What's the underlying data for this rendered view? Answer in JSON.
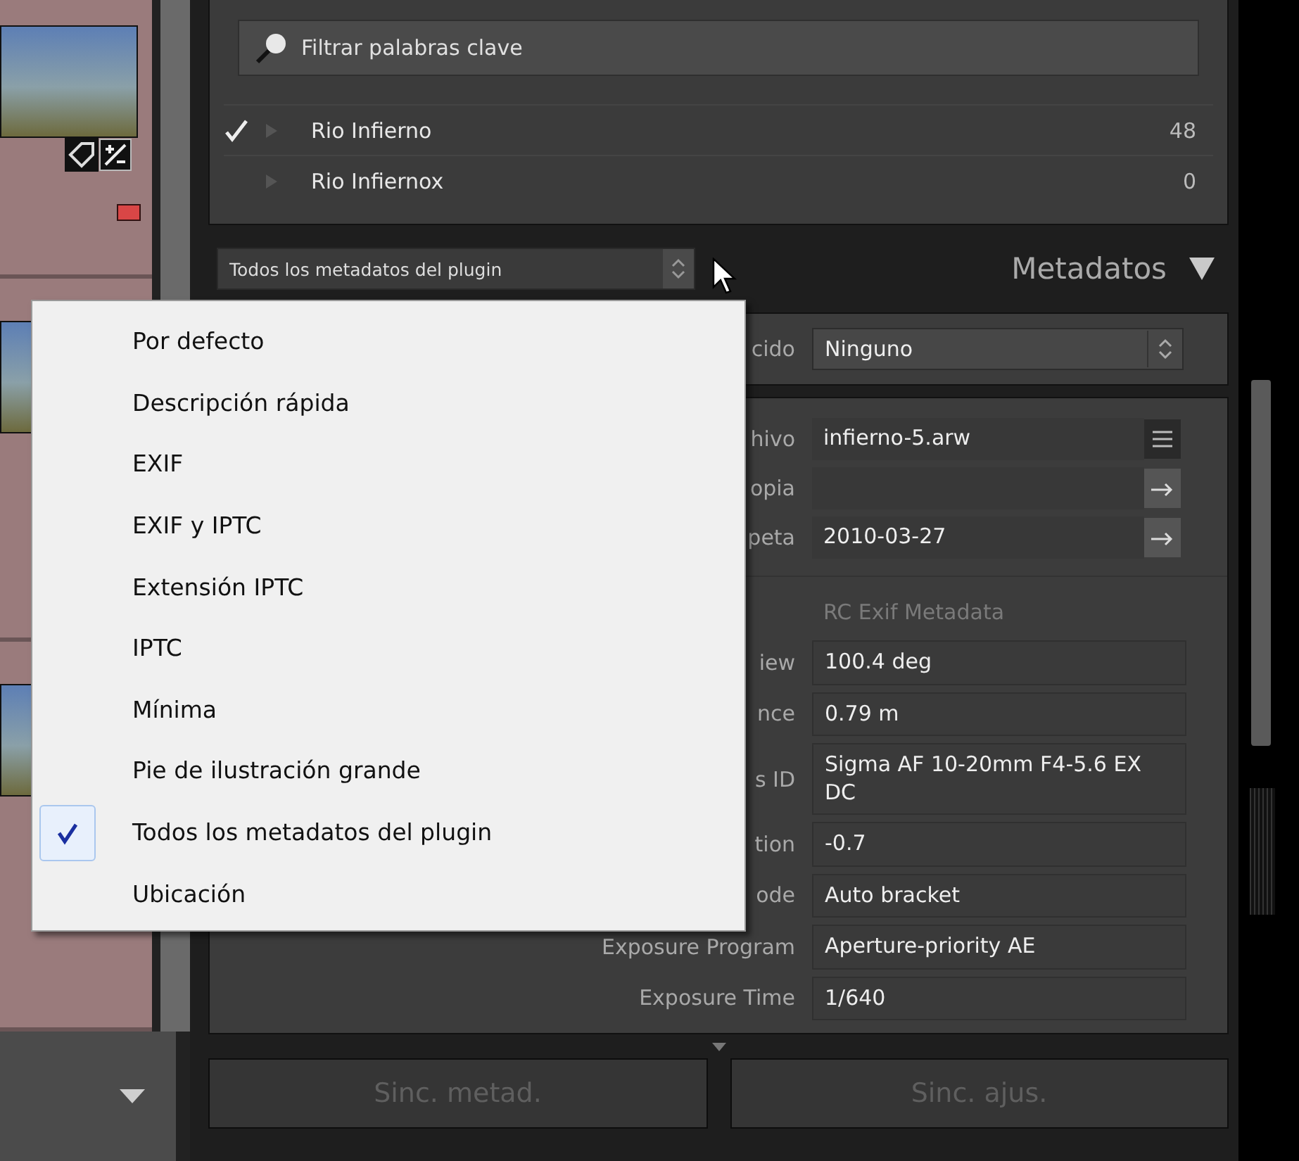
{
  "keywords": {
    "filter": {
      "placeholder": "Filtrar palabras clave"
    },
    "items": [
      {
        "name": "Rio Infierno",
        "count": "48",
        "checked": true
      },
      {
        "name": "Rio Infiernox",
        "count": "0",
        "checked": false
      }
    ]
  },
  "metadata": {
    "preset": "Todos los metadatos del plugin",
    "title": "Metadatos",
    "expanded": true,
    "default_row": {
      "label": "cido",
      "value": "Ninguno"
    },
    "fields": [
      {
        "kind": "list",
        "label": "hivo",
        "value": "infierno-5.arw"
      },
      {
        "kind": "arrow",
        "label": "opia"
      },
      {
        "kind": "arrow",
        "label": "peta",
        "value": "2010-03-27"
      }
    ],
    "exif": {
      "title": "RC Exif Metadata",
      "rows": [
        {
          "label": "iew",
          "value": "100.4 deg"
        },
        {
          "label": "nce",
          "value": "0.79 m"
        },
        {
          "label": "s ID",
          "value": "Sigma AF 10-20mm F4-5.6 EX DC"
        },
        {
          "label": "tion",
          "value": "-0.7"
        },
        {
          "label": "ode",
          "value": "Auto bracket"
        },
        {
          "label": "Exposure Program",
          "value": "Aperture-priority AE"
        },
        {
          "label": "Exposure Time",
          "value": "1/640"
        }
      ]
    }
  },
  "buttons": [
    "Sinc. metad.",
    "Sinc. ajus."
  ],
  "preset_menu": {
    "items": [
      {
        "label": "Por defecto",
        "selected": false
      },
      {
        "label": "Descripción rápida",
        "selected": false
      },
      {
        "label": "EXIF",
        "selected": false
      },
      {
        "label": "EXIF y IPTC",
        "selected": false
      },
      {
        "label": "Extensión IPTC",
        "selected": false
      },
      {
        "label": "IPTC",
        "selected": false
      },
      {
        "label": "Mínima",
        "selected": false
      },
      {
        "label": "Pie de ilustración grande",
        "selected": false
      },
      {
        "label": "Todos los metadatos del plugin",
        "selected": true
      },
      {
        "label": "Ubicación",
        "selected": false
      }
    ]
  }
}
